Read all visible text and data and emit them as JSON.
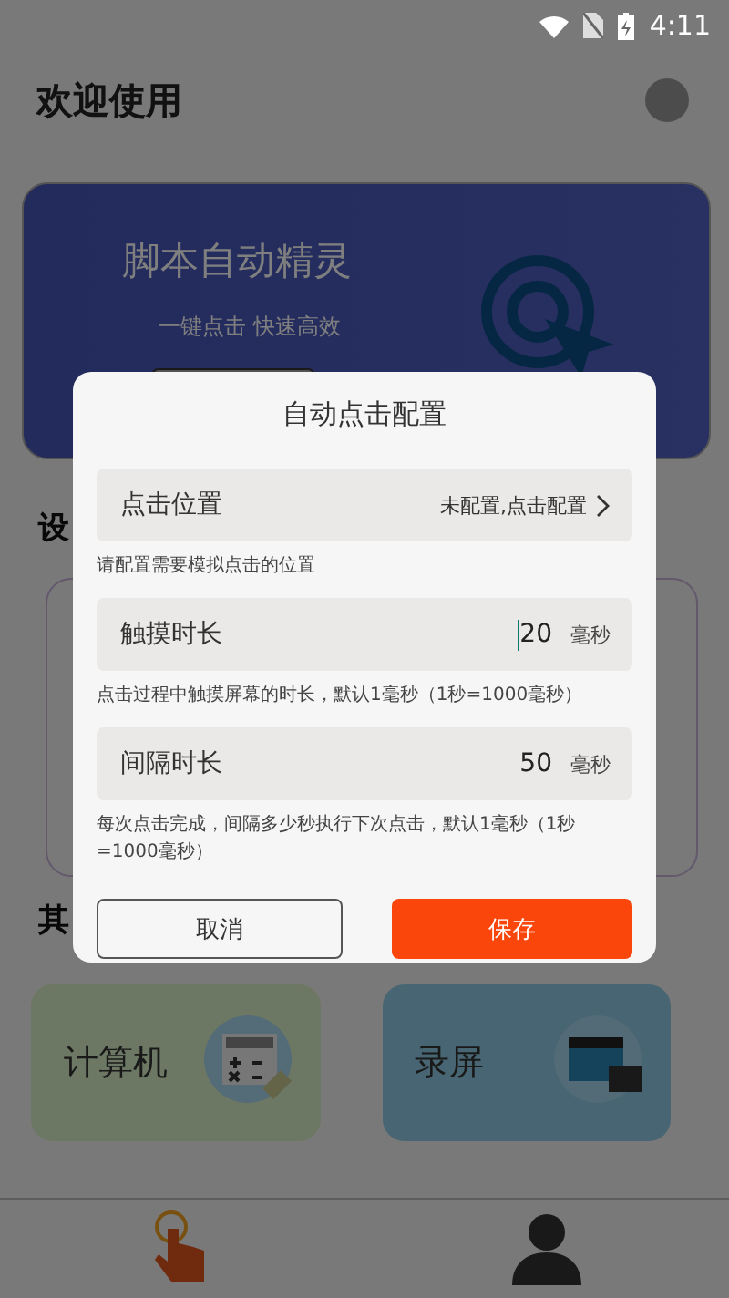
{
  "status_bar": {
    "time": "4:11"
  },
  "header": {
    "title": "欢迎使用"
  },
  "banner": {
    "title": "脚本自动精灵",
    "subtitle": "一键点击  快速高效"
  },
  "sections": [
    {
      "title": "设"
    },
    {
      "title": "其"
    }
  ],
  "tools": [
    {
      "label": "计算机",
      "kind": "calculator"
    },
    {
      "label": "录屏",
      "kind": "recorder"
    }
  ],
  "nav": [
    {
      "kind": "tap",
      "selected": true
    },
    {
      "kind": "profile",
      "selected": false
    }
  ],
  "dialog": {
    "title": "自动点击配置",
    "location": {
      "label": "点击位置",
      "value": "未配置,点击配置",
      "hint": "请配置需要模拟点击的位置"
    },
    "fields": [
      {
        "label": "触摸时长",
        "value": "20",
        "unit": "毫秒",
        "focused": true,
        "hint": "点击过程中触摸屏幕的时长，默认1毫秒（1秒=1000毫秒）"
      },
      {
        "label": "间隔时长",
        "value": "50",
        "unit": "毫秒",
        "focused": false,
        "hint": "每次点击完成，间隔多少秒执行下次点击，默认1毫秒（1秒=1000毫秒）"
      }
    ],
    "cancel": "取消",
    "save": "保存"
  }
}
